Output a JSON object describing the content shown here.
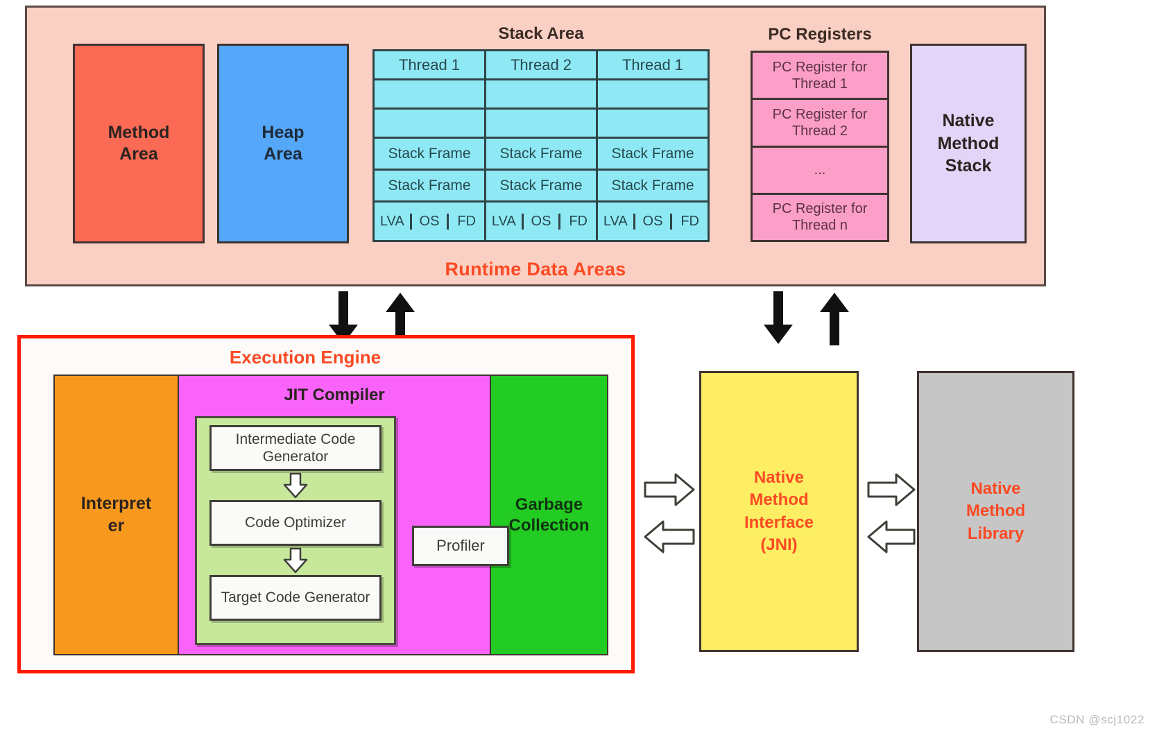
{
  "runtime": {
    "title": "Runtime Data Areas",
    "method_area": "Method\nArea",
    "method_area_line1": "Method",
    "method_area_line2": "Area",
    "heap_area_line1": "Heap",
    "heap_area_line2": "Area",
    "stack": {
      "heading": "Stack Area",
      "columns": [
        {
          "header": "Thread 1",
          "blank_rows": 2,
          "frames": [
            "Stack Frame",
            "Stack Frame"
          ],
          "units": [
            "LVA",
            "OS",
            "FD"
          ]
        },
        {
          "header": "Thread 2",
          "blank_rows": 2,
          "frames": [
            "Stack Frame",
            "Stack Frame"
          ],
          "units": [
            "LVA",
            "OS",
            "FD"
          ]
        },
        {
          "header": "Thread 1",
          "blank_rows": 2,
          "frames": [
            "Stack Frame",
            "Stack Frame"
          ],
          "units": [
            "LVA",
            "OS",
            "FD"
          ]
        }
      ]
    },
    "pc_registers": {
      "heading": "PC Registers",
      "cells": [
        "PC Register for Thread 1",
        "PC Register for Thread 2",
        "...",
        "PC Register for Thread n"
      ]
    },
    "native_method_stack_line1": "Native",
    "native_method_stack_line2": "Method",
    "native_method_stack_line3": "Stack"
  },
  "execution_engine": {
    "title": "Execution Engine",
    "interpreter_line1": "Interpret",
    "interpreter_line2": "er",
    "jit": {
      "title": "JIT Compiler",
      "stages": [
        "Intermediate Code Generator",
        "Code Optimizer",
        "Target Code Generator"
      ],
      "profiler": "Profiler"
    },
    "garbage_collection_line1": "Garbage",
    "garbage_collection_line2": "Collection"
  },
  "jni": {
    "line1": "Native",
    "line2": "Method",
    "line3": "Interface",
    "line4": "(JNI)"
  },
  "native_method_library": {
    "line1": "Native",
    "line2": "Method",
    "line3": "Library"
  },
  "watermark": "CSDN @scj1022",
  "colors": {
    "runtime_bg": "#FBD0C4",
    "method_area": "#FA6A55",
    "heap_area": "#54A7F9",
    "stack_cell": "#8FE9F5",
    "pc_register": "#FB9FC8",
    "native_method_stack": "#E2D6F8",
    "interpreter": "#F8991D",
    "jit": "#F963F9",
    "jit_inner": "#C7E89B",
    "garbage_collection": "#22CC22",
    "jni": "#FDEE63",
    "native_method_library": "#C6C6C6",
    "accent_red": "#FB4A24",
    "engine_border": "#FF1A00"
  }
}
